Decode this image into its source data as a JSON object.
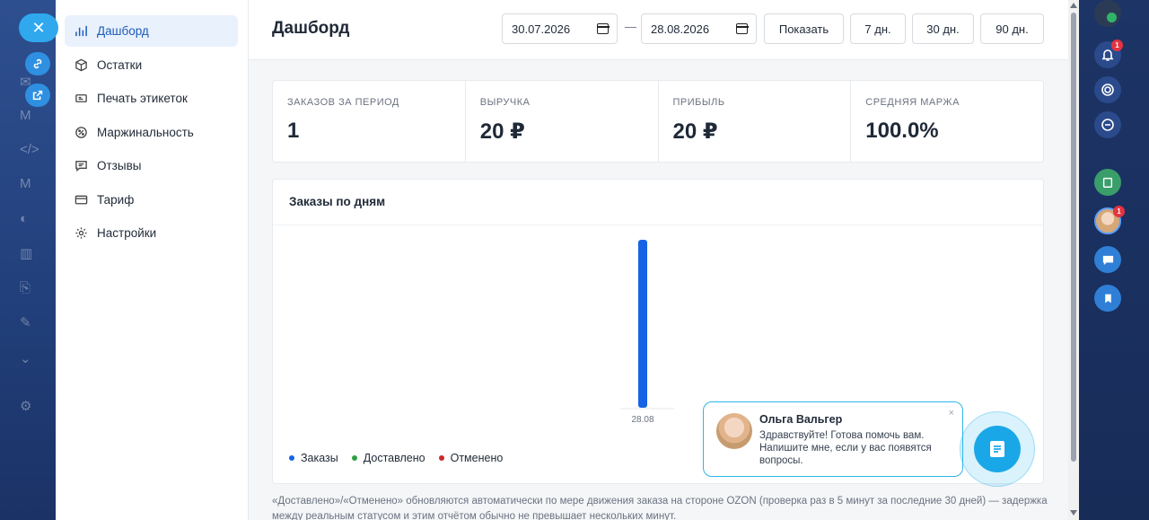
{
  "nav": {
    "items": [
      {
        "label": "Дашборд",
        "icon": "bar-chart-icon"
      },
      {
        "label": "Остатки",
        "icon": "box-icon"
      },
      {
        "label": "Печать этикеток",
        "icon": "label-icon"
      },
      {
        "label": "Маржинальность",
        "icon": "percent-icon"
      },
      {
        "label": "Отзывы",
        "icon": "message-icon"
      },
      {
        "label": "Тариф",
        "icon": "card-icon"
      },
      {
        "label": "Настройки",
        "icon": "gear-icon"
      }
    ]
  },
  "header": {
    "title": "Дашборд",
    "date_from": "30.07.2026",
    "date_separator": "—",
    "date_to": "28.08.2026",
    "show_label": "Показать",
    "range_7": "7 дн.",
    "range_30": "30 дн.",
    "range_90": "90 дн."
  },
  "kpis": [
    {
      "label": "Заказов за период",
      "value": "1"
    },
    {
      "label": "Выручка",
      "value": "20 ₽"
    },
    {
      "label": "Прибыль",
      "value": "20 ₽"
    },
    {
      "label": "Средняя маржа",
      "value": "100.0%"
    }
  ],
  "chart_card": {
    "title": "Заказы по дням"
  },
  "chart_data": {
    "type": "bar",
    "categories": [
      "28.08"
    ],
    "series": [
      {
        "name": "Заказы",
        "values": [
          1
        ],
        "color": "#1763e6"
      },
      {
        "name": "Доставлено",
        "values": [
          0
        ],
        "color": "#2f9e44"
      },
      {
        "name": "Отменено",
        "values": [
          0
        ],
        "color": "#c92a2a"
      }
    ],
    "ylim": [
      0,
      1
    ]
  },
  "footnote": "«Доставлено»/«Отменено» обновляются автоматически по мере движения заказа на стороне OZON (проверка раз в 5 минут за последние 30 дней) — задержка между реальным статусом и этим отчётом обычно не превышает нескольких минут.",
  "chat": {
    "name": "Ольга Вальгер",
    "message": "Здравствуйте! Готова помочь вам. Напишите мне, если у вас появятся вопросы.",
    "close": "×"
  },
  "right_bar": {
    "notif_badge": "1",
    "avatar_badge": "1"
  },
  "close_label": "✕"
}
